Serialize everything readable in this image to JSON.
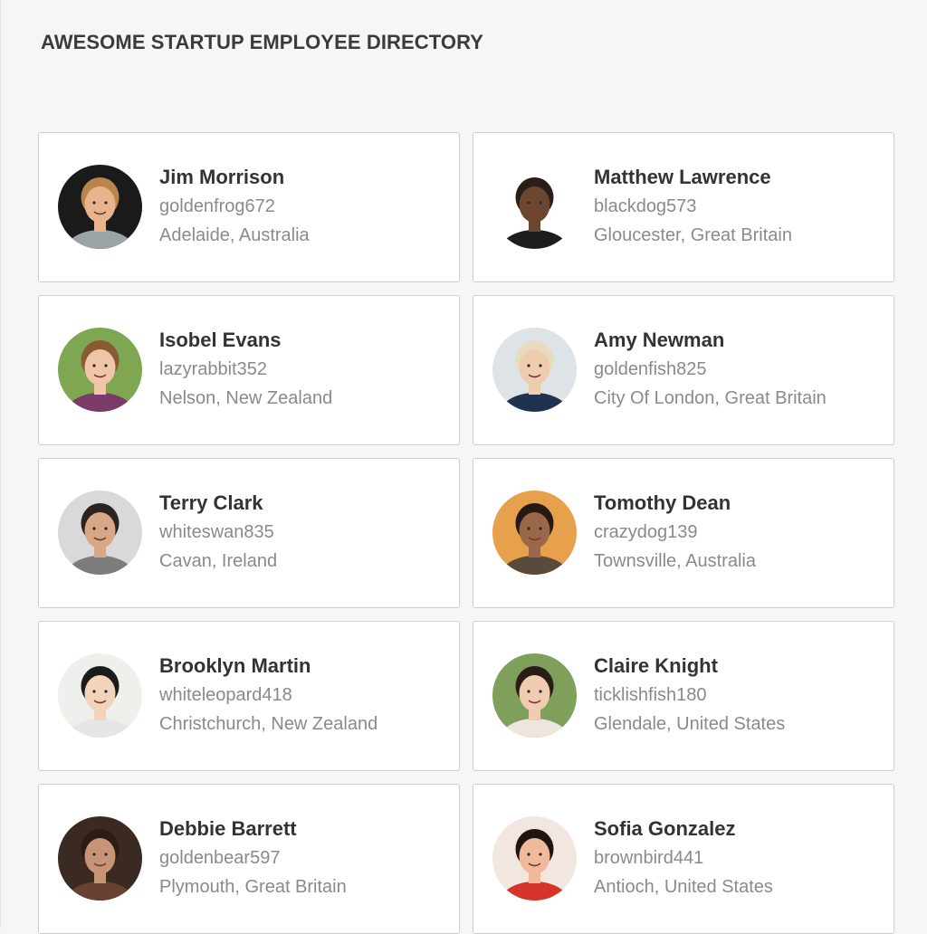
{
  "header": {
    "title": "AWESOME STARTUP EMPLOYEE DIRECTORY"
  },
  "employees": [
    {
      "name": "Jim Morrison",
      "username": "goldenfrog672",
      "location": "Adelaide, Australia",
      "bg": "#1a1a1a",
      "skin": "#e8b48e",
      "hair": "#b8864a",
      "shirt": "#9aa3a6"
    },
    {
      "name": "Matthew Lawrence",
      "username": "blackdog573",
      "location": "Gloucester, Great Britain",
      "bg": "#ffffff",
      "skin": "#6b4631",
      "hair": "#2a1f18",
      "shirt": "#1d1d1d"
    },
    {
      "name": "Isobel Evans",
      "username": "lazyrabbit352",
      "location": "Nelson, New Zealand",
      "bg": "#7fa650",
      "skin": "#efc6a6",
      "hair": "#8a5a34",
      "shirt": "#7a3a6a"
    },
    {
      "name": "Amy Newman",
      "username": "goldenfish825",
      "location": "City Of London, Great Britain",
      "bg": "#dde3e6",
      "skin": "#f0ccae",
      "hair": "#e8dcc0",
      "shirt": "#1f3350"
    },
    {
      "name": "Terry Clark",
      "username": "whiteswan835",
      "location": "Cavan, Ireland",
      "bg": "#d9d9d9",
      "skin": "#d8a788",
      "hair": "#2c2420",
      "shirt": "#7c7c7c"
    },
    {
      "name": "Tomothy Dean",
      "username": "crazydog139",
      "location": "Townsville, Australia",
      "bg": "#e7a04c",
      "skin": "#9a6848",
      "hair": "#231a15",
      "shirt": "#5a4a3a"
    },
    {
      "name": "Brooklyn Martin",
      "username": "whiteleopard418",
      "location": "Christchurch, New Zealand",
      "bg": "#eef0ec",
      "skin": "#f2d3bc",
      "hair": "#1b1b1b",
      "shirt": "#e6e6e6"
    },
    {
      "name": "Claire Knight",
      "username": "ticklishfish180",
      "location": "Glendale, United States",
      "bg": "#7ea05a",
      "skin": "#f0cdb2",
      "hair": "#2a1d16",
      "shirt": "#ede6df"
    },
    {
      "name": "Debbie Barrett",
      "username": "goldenbear597",
      "location": "Plymouth, Great Britain",
      "bg": "#3a2a22",
      "skin": "#c89478",
      "hair": "#2b1c16",
      "shirt": "#6a4030"
    },
    {
      "name": "Sofia Gonzalez",
      "username": "brownbird441",
      "location": "Antioch, United States",
      "bg": "#f2e6e0",
      "skin": "#f0b99a",
      "hair": "#1e1412",
      "shirt": "#d4342a"
    }
  ]
}
